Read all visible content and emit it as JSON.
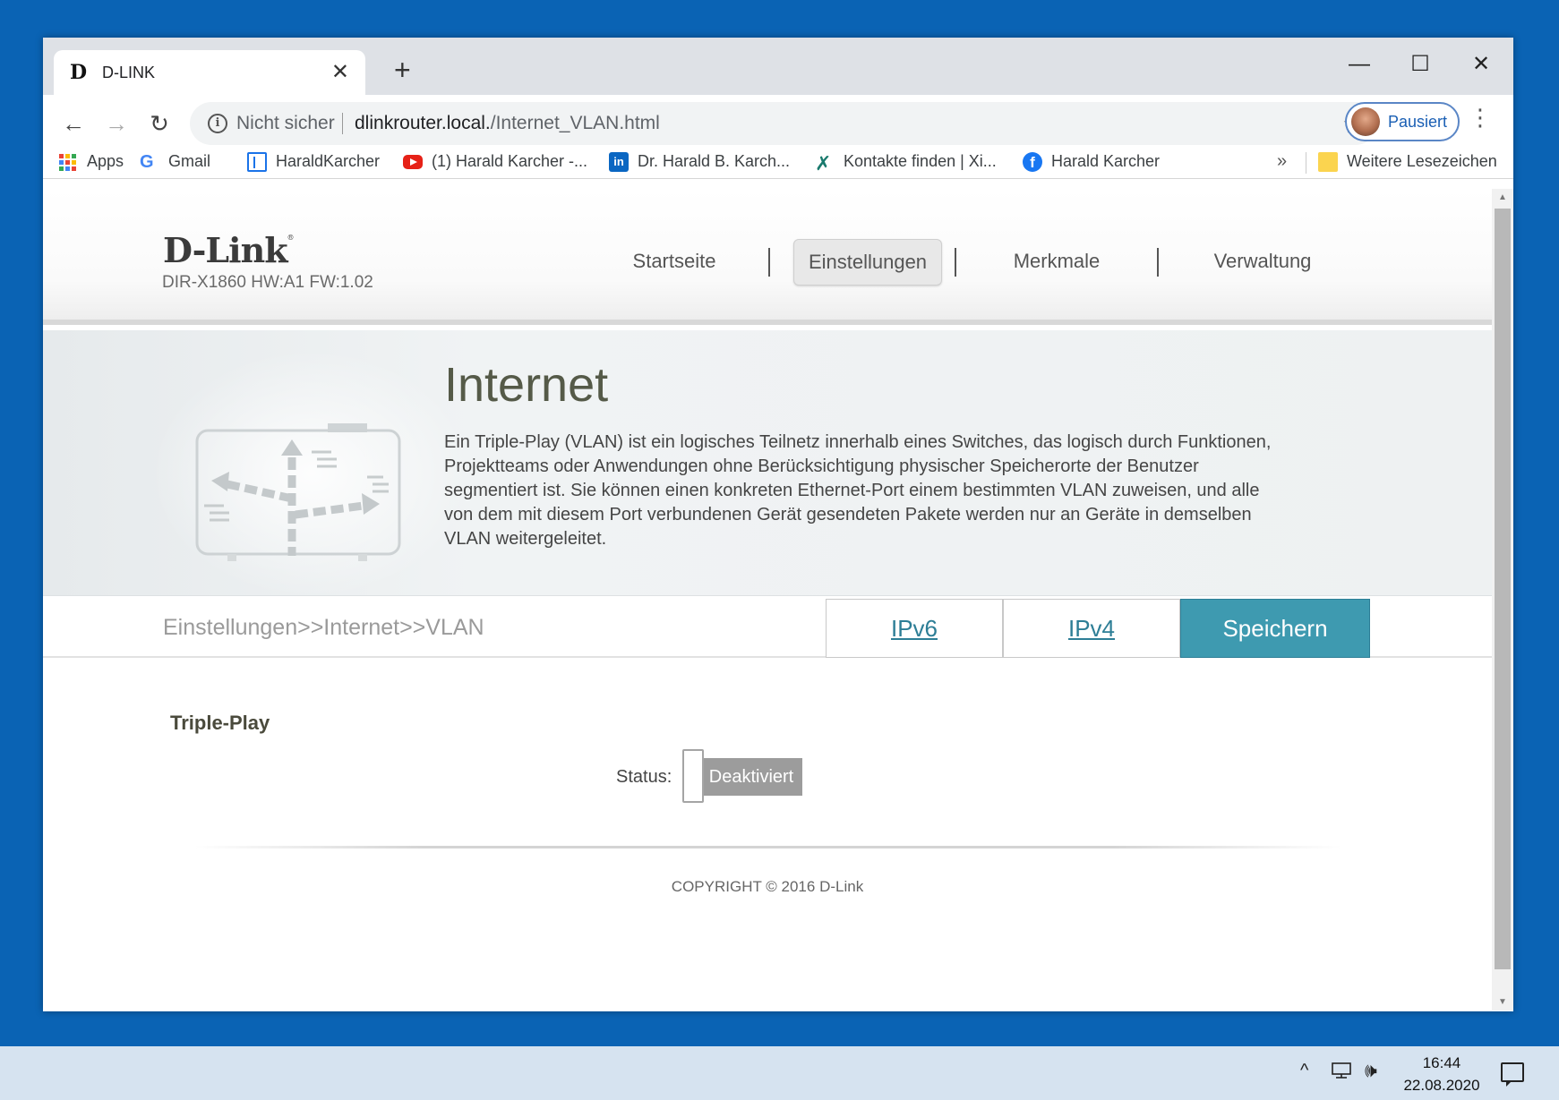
{
  "browser": {
    "tab_title": "D-LINK",
    "tab_favicon": "D",
    "tab_close": "✕",
    "new_tab": "+",
    "window_controls": {
      "minimize": "—",
      "maximize": "☐",
      "close": "✕"
    },
    "nav": {
      "back": "←",
      "forward": "→",
      "reload": "↻"
    },
    "security_label": "Nicht sicher",
    "url_host": "dlinkrouter.local.",
    "url_path": "/Internet_VLAN.html",
    "bookmark_star": "☆",
    "profile_label": "Pausiert",
    "menu": "⋮"
  },
  "bookmarks": {
    "items": [
      {
        "label": "Apps",
        "icon": "apps-grid-icon"
      },
      {
        "label": "Gmail",
        "icon": "google-icon"
      },
      {
        "label": "HaraldKarcher",
        "icon": "page-icon"
      },
      {
        "label": "(1) Harald Karcher -...",
        "icon": "youtube-icon"
      },
      {
        "label": "Dr. Harald B. Karch...",
        "icon": "linkedin-icon"
      },
      {
        "label": "Kontakte finden | Xi...",
        "icon": "xing-icon"
      },
      {
        "label": "Harald Karcher",
        "icon": "facebook-icon"
      }
    ],
    "more": "»",
    "other_bookmarks": "Weitere Lesezeichen"
  },
  "router": {
    "logo": "D-Link",
    "logo_mark": "®",
    "model": "DIR-X1860 HW:A1 FW:1.02",
    "nav": [
      "Startseite",
      "Einstellungen",
      "Merkmale",
      "Verwaltung"
    ],
    "active_nav": "Einstellungen",
    "banner_title": "Internet",
    "banner_description": "Ein Triple-Play (VLAN) ist ein logisches Teilnetz innerhalb eines Switches, das logisch durch Funktionen, Projektteams oder Anwendungen ohne Berücksichtigung physischer Speicherorte der Benutzer segmentiert ist. Sie können einen konkreten Ethernet-Port einem bestimmten VLAN zuweisen, und alle von dem mit diesem Port verbundenen Gerät gesendeten Pakete werden nur an Geräte in demselben VLAN weitergeleitet.",
    "breadcrumb": "Einstellungen>>Internet>>VLAN",
    "buttons": {
      "ipv6": "IPv6",
      "ipv4": "IPv4",
      "save": "Speichern"
    },
    "section_title": "Triple-Play",
    "status_label": "Status:",
    "status_value": "Deaktiviert",
    "copyright": "COPYRIGHT © 2016 D-Link"
  },
  "taskbar": {
    "time": "16:44",
    "date": "22.08.2020",
    "tray_chevron": "^",
    "volume": "🕪"
  },
  "colors": {
    "desktop": "#0a63b4",
    "accent_button": "#3e9ab0",
    "link": "#2d7e96",
    "toggle_off": "#9c9c9c"
  }
}
